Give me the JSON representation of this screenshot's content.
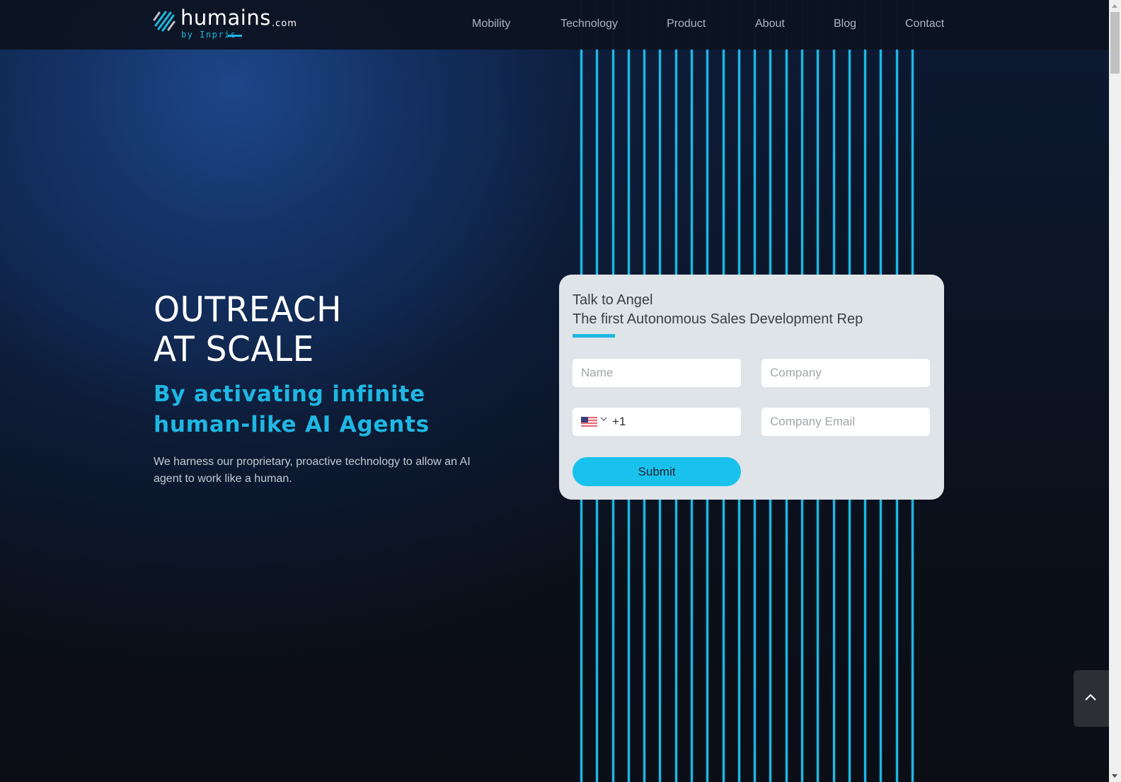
{
  "header": {
    "logo": {
      "icon": "humains-stripes-logo-icon",
      "word": "humains",
      "tld": ".com",
      "by_line": "by Inpris"
    },
    "nav": [
      {
        "label": "Mobility"
      },
      {
        "label": "Technology"
      },
      {
        "label": "Product"
      },
      {
        "label": "About"
      },
      {
        "label": "Blog"
      },
      {
        "label": "Contact"
      }
    ]
  },
  "hero": {
    "title_line1": "OUTREACH",
    "title_line2": "AT SCALE",
    "subtitle_line1": "By activating infinite",
    "subtitle_line2": "human-like AI Agents",
    "description": "We harness our proprietary, proactive technology to allow an AI agent to work like a human."
  },
  "form": {
    "title": "Talk to Angel",
    "subtitle": "The first Autonomous Sales Development Rep",
    "fields": {
      "name": {
        "placeholder": "Name",
        "value": ""
      },
      "company": {
        "placeholder": "Company",
        "value": ""
      },
      "phone": {
        "country_flag": "us-flag-icon",
        "country_code": "+1",
        "value": ""
      },
      "email": {
        "placeholder": "Company Email",
        "value": ""
      }
    },
    "submit_label": "Submit"
  },
  "scroll_top": {
    "icon": "chevron-up-icon"
  },
  "theme": {
    "accent": "#1fb7e2",
    "button": "#19c2ec",
    "card_bg": "#dfe4e9",
    "page_bg": "#0b0e15"
  },
  "decor": {
    "vertical_line_count": 22
  }
}
